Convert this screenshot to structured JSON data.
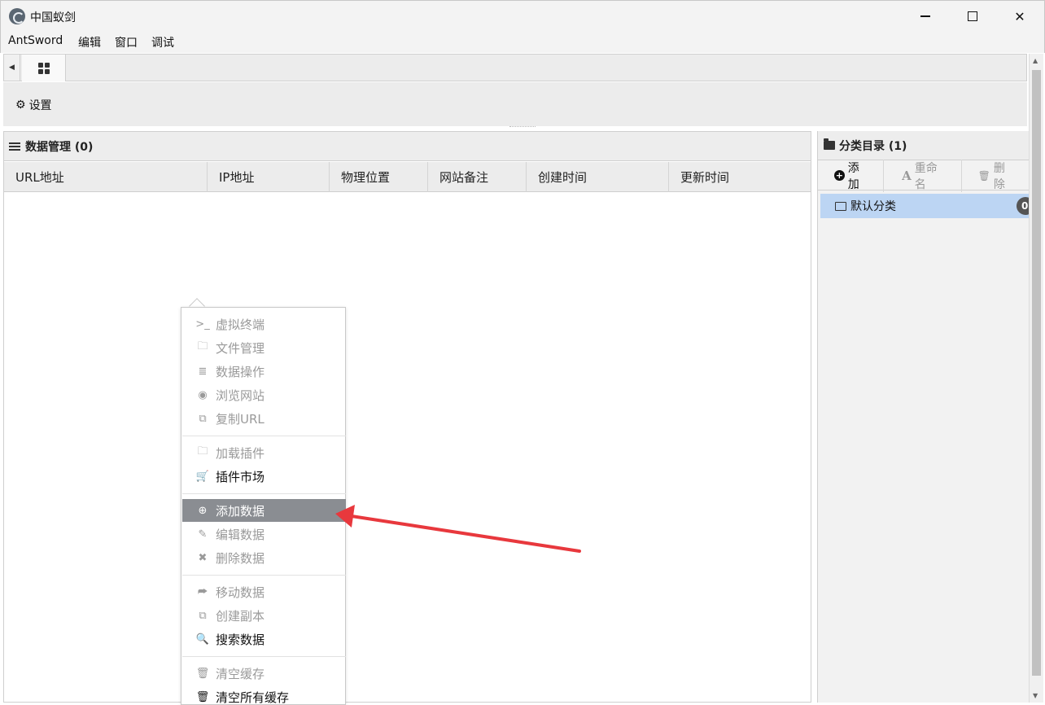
{
  "window": {
    "title": "中国蚁剑",
    "controls": {
      "min": "minimize-icon",
      "max": "maximize-icon",
      "close": "✕"
    }
  },
  "menubar": {
    "items": [
      "AntSword",
      "编辑",
      "窗口",
      "调试"
    ]
  },
  "tabs": {
    "home_icon": "grid-icon",
    "scroll_left": "◀"
  },
  "toolbar": {
    "settings_label": "设置",
    "settings_icon": "gear-icon"
  },
  "data_panel": {
    "title": "数据管理 (0)",
    "columns": [
      "URL地址",
      "IP地址",
      "物理位置",
      "网站备注",
      "创建时间",
      "更新时间"
    ]
  },
  "category_panel": {
    "title": "分类目录 (1)",
    "collapse_icon": "›",
    "buttons": {
      "add": "添加",
      "rename": "重命名",
      "delete": "删除"
    },
    "items": [
      {
        "label": "默认分类",
        "count": "0"
      }
    ]
  },
  "context_menu": {
    "groups": [
      [
        {
          "label": "虚拟终端",
          "icon": "terminal-icon",
          "glyph": ">_",
          "enabled": false
        },
        {
          "label": "文件管理",
          "icon": "folder-icon",
          "glyph": "🗀",
          "enabled": false
        },
        {
          "label": "数据操作",
          "icon": "database-icon",
          "glyph": "≣",
          "enabled": false
        },
        {
          "label": "浏览网站",
          "icon": "chrome-icon",
          "glyph": "◉",
          "enabled": false
        },
        {
          "label": "复制URL",
          "icon": "copy-icon",
          "glyph": "⧉",
          "enabled": false
        }
      ],
      [
        {
          "label": "加载插件",
          "icon": "folder-icon",
          "glyph": "🗀",
          "enabled": false
        },
        {
          "label": "插件市场",
          "icon": "cart-icon",
          "glyph": "🛒",
          "enabled": true
        }
      ],
      [
        {
          "label": "添加数据",
          "icon": "plus-circle-icon",
          "glyph": "⊕",
          "enabled": true,
          "active": true
        },
        {
          "label": "编辑数据",
          "icon": "edit-icon",
          "glyph": "✎",
          "enabled": false
        },
        {
          "label": "删除数据",
          "icon": "close-icon",
          "glyph": "✖",
          "enabled": false
        }
      ],
      [
        {
          "label": "移动数据",
          "icon": "share-icon",
          "glyph": "⮫",
          "enabled": false
        },
        {
          "label": "创建副本",
          "icon": "copy-icon",
          "glyph": "⧉",
          "enabled": false
        },
        {
          "label": "搜索数据",
          "icon": "search-icon",
          "glyph": "🔍",
          "enabled": true
        }
      ],
      [
        {
          "label": "清空缓存",
          "icon": "trash-icon",
          "glyph": "🗑",
          "enabled": false
        },
        {
          "label": "清空所有缓存",
          "icon": "trash-icon",
          "glyph": "🗑",
          "enabled": true
        }
      ]
    ]
  },
  "annotation": {
    "arrow_color": "#e8383d"
  }
}
